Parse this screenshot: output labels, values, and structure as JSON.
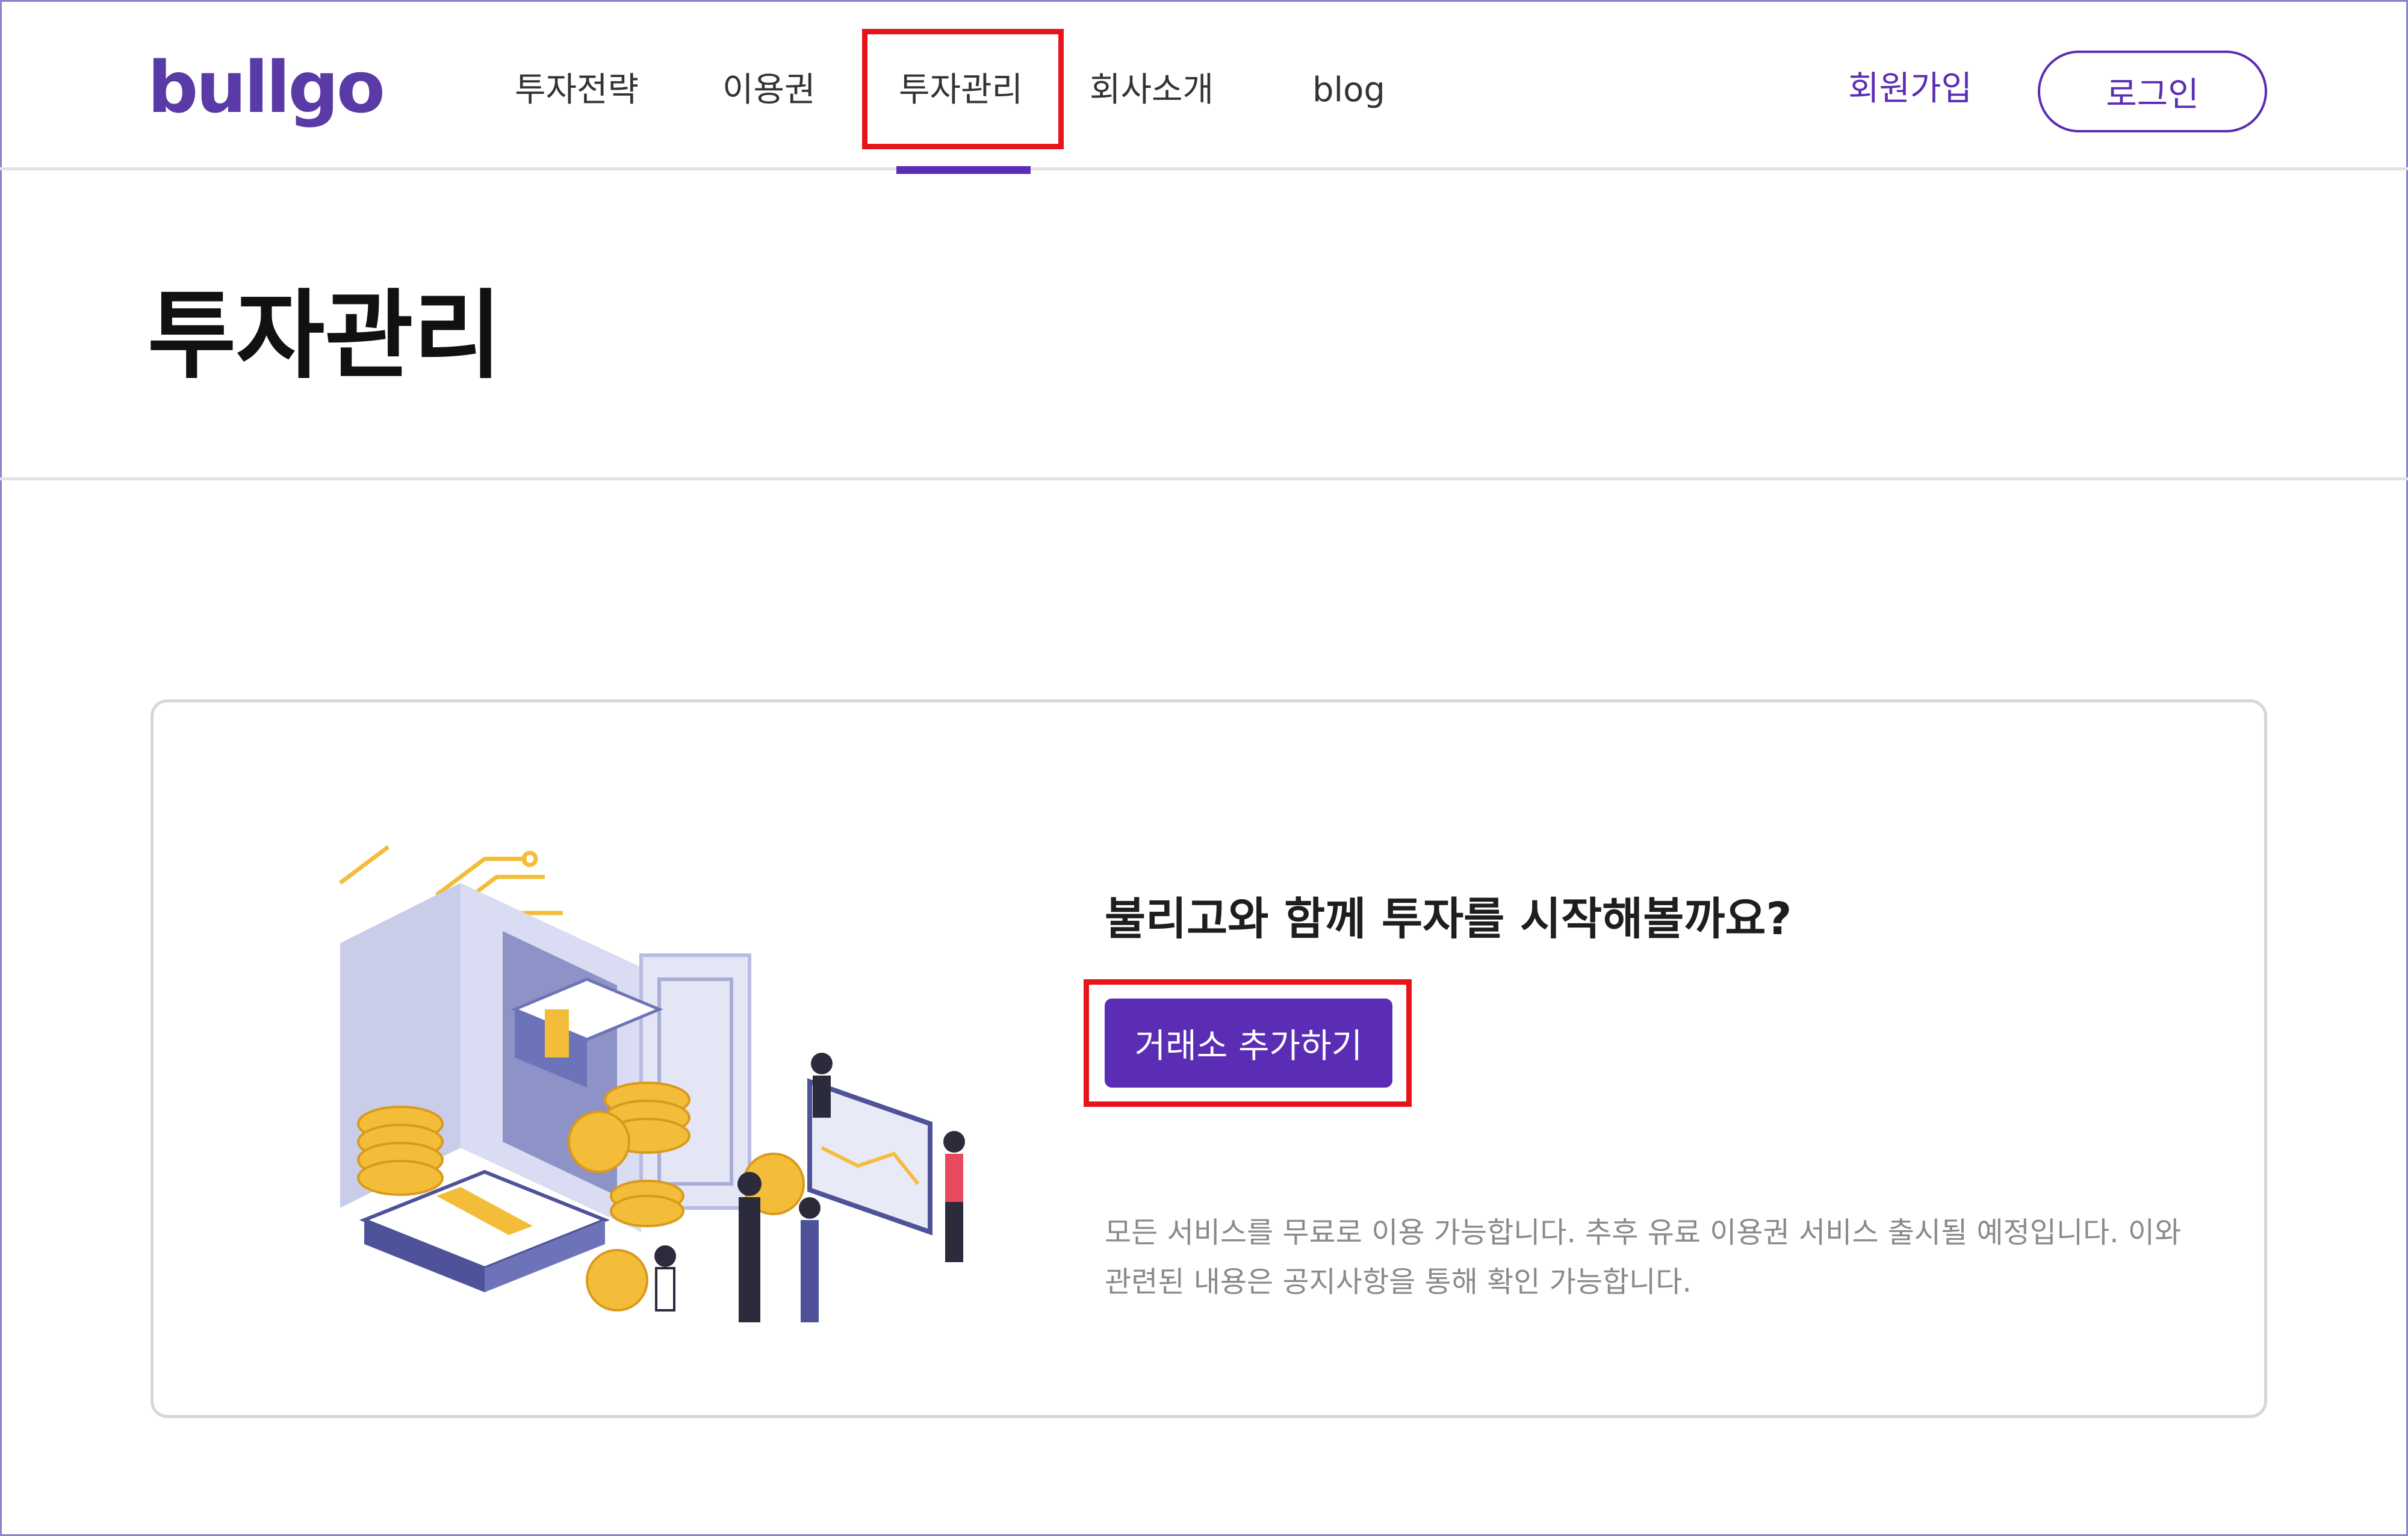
{
  "header": {
    "logo": "bullgo",
    "nav": [
      {
        "label": "투자전략"
      },
      {
        "label": "이용권"
      },
      {
        "label": "투자관리"
      },
      {
        "label": "회사소개"
      },
      {
        "label": "blog"
      }
    ],
    "signup_label": "회원가입",
    "login_label": "로그인"
  },
  "page": {
    "title": "투자관리"
  },
  "card": {
    "heading": "불리고와 함께 투자를 시작해볼까요?",
    "cta_label": "거래소 추가하기",
    "note": "모든 서비스를 무료로 이용 가능합니다. 추후 유료 이용권 서비스 출시될 예정입니다. 이와 관련된 내용은 공지사항을 통해 확인 가능합니다."
  },
  "colors": {
    "brand": "#5a2db4",
    "highlight": "#e8141c",
    "coin": "#f3bd3a",
    "vault": "#c9cdea"
  }
}
